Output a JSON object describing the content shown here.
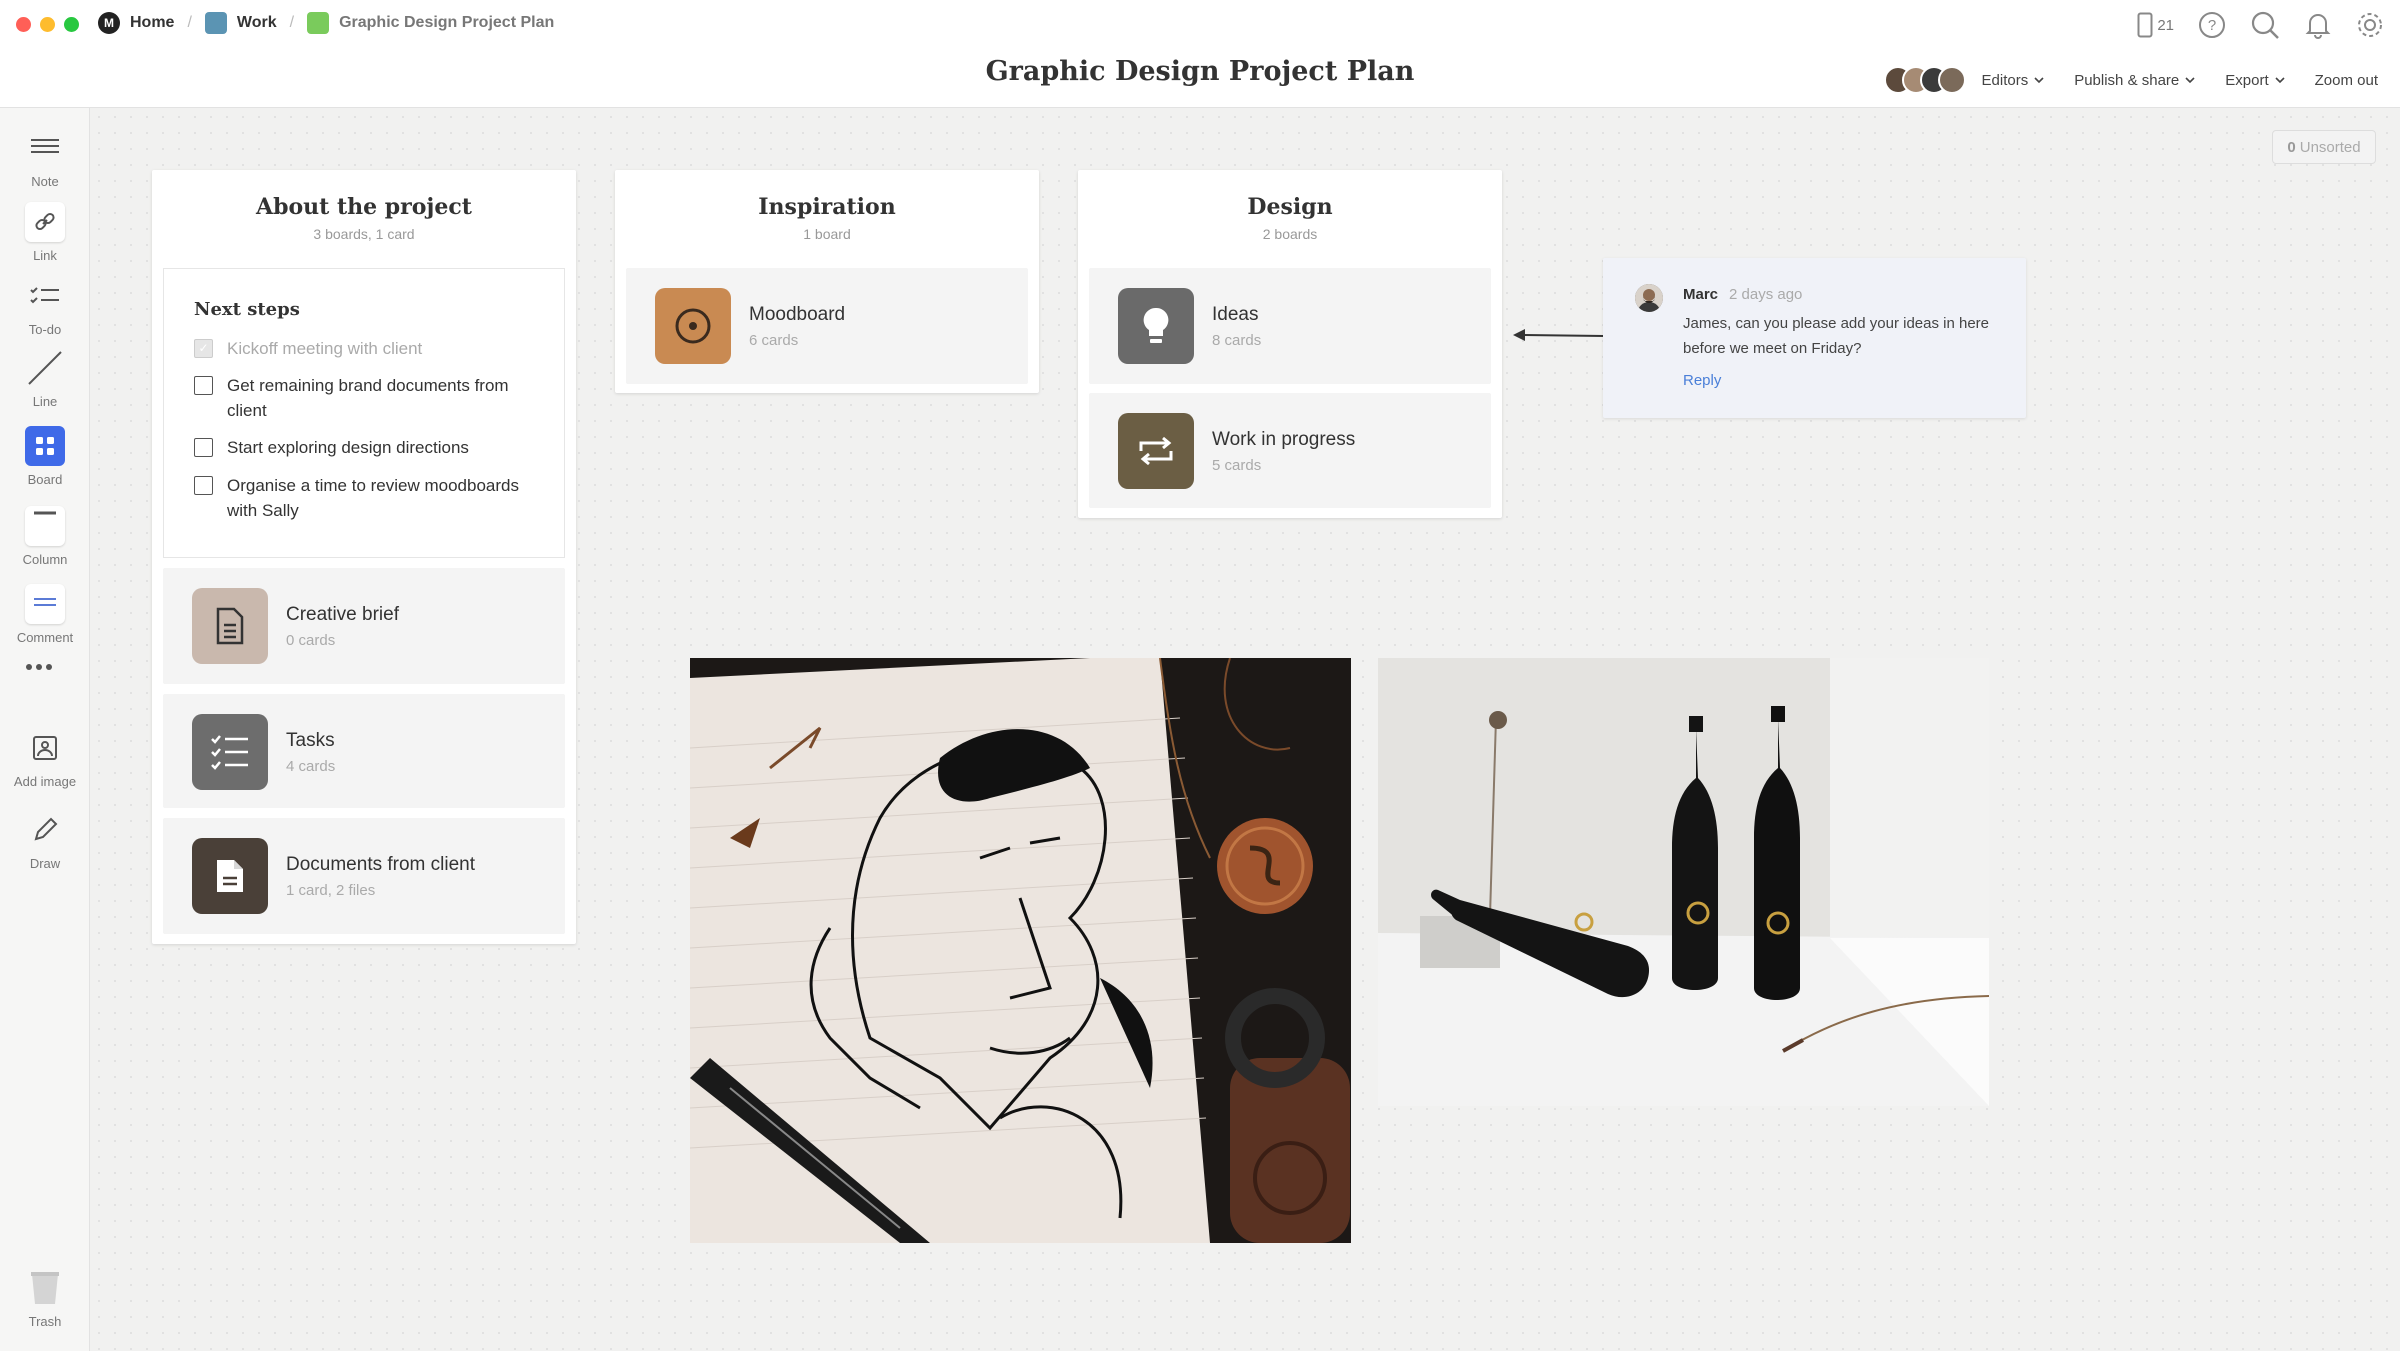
{
  "window": {
    "breadcrumbs": [
      {
        "label": "Home"
      },
      {
        "label": "Work"
      },
      {
        "label": "Graphic Design Project Plan"
      }
    ],
    "title": "Graphic Design Project Plan",
    "device_count": "21",
    "colors": {
      "traffic_red": "#ff5f57",
      "traffic_yellow": "#febc2e",
      "traffic_green": "#28c840",
      "work_icon": "#5b94b3",
      "plan_icon": "#7acb5c"
    }
  },
  "toolbar": {
    "editors": "Editors",
    "publish": "Publish & share",
    "export": "Export",
    "zoom": "Zoom out"
  },
  "sidebar": {
    "note": "Note",
    "link": "Link",
    "todo": "To-do",
    "line": "Line",
    "board": "Board",
    "column": "Column",
    "comment": "Comment",
    "add_image": "Add image",
    "draw": "Draw",
    "trash": "Trash"
  },
  "unsorted": {
    "count": "0",
    "label": "Unsorted"
  },
  "columns": {
    "about": {
      "title": "About the project",
      "subtitle": "3 boards, 1 card",
      "todo": {
        "title": "Next steps",
        "items": [
          {
            "text": "Kickoff meeting with client",
            "done": true
          },
          {
            "text": "Get remaining brand documents from client",
            "done": false
          },
          {
            "text": "Start exploring design directions",
            "done": false
          },
          {
            "text": "Organise a time to review moodboards with Sally",
            "done": false
          }
        ]
      },
      "cards": [
        {
          "title": "Creative brief",
          "subtitle": "0 cards",
          "icon": "document-icon",
          "color": "#c9b8ad"
        },
        {
          "title": "Tasks",
          "subtitle": "4 cards",
          "icon": "checklist-icon",
          "color": "#6d6d6d"
        },
        {
          "title": "Documents from client",
          "subtitle": "1 card, 2 files",
          "icon": "file-icon",
          "color": "#4a4038"
        }
      ]
    },
    "inspiration": {
      "title": "Inspiration",
      "subtitle": "1 board",
      "cards": [
        {
          "title": "Moodboard",
          "subtitle": "6 cards",
          "icon": "target-icon",
          "color": "#c98a52"
        }
      ]
    },
    "design": {
      "title": "Design",
      "subtitle": "2 boards",
      "cards": [
        {
          "title": "Ideas",
          "subtitle": "8 cards",
          "icon": "lightbulb-icon",
          "color": "#6a6a6a"
        },
        {
          "title": "Work in progress",
          "subtitle": "5 cards",
          "icon": "repeat-icon",
          "color": "#6b5e44"
        }
      ]
    }
  },
  "comment": {
    "author": "Marc",
    "time": "2 days ago",
    "text": "James, can you please add your ideas in here before we meet on Friday?",
    "reply": "Reply"
  }
}
